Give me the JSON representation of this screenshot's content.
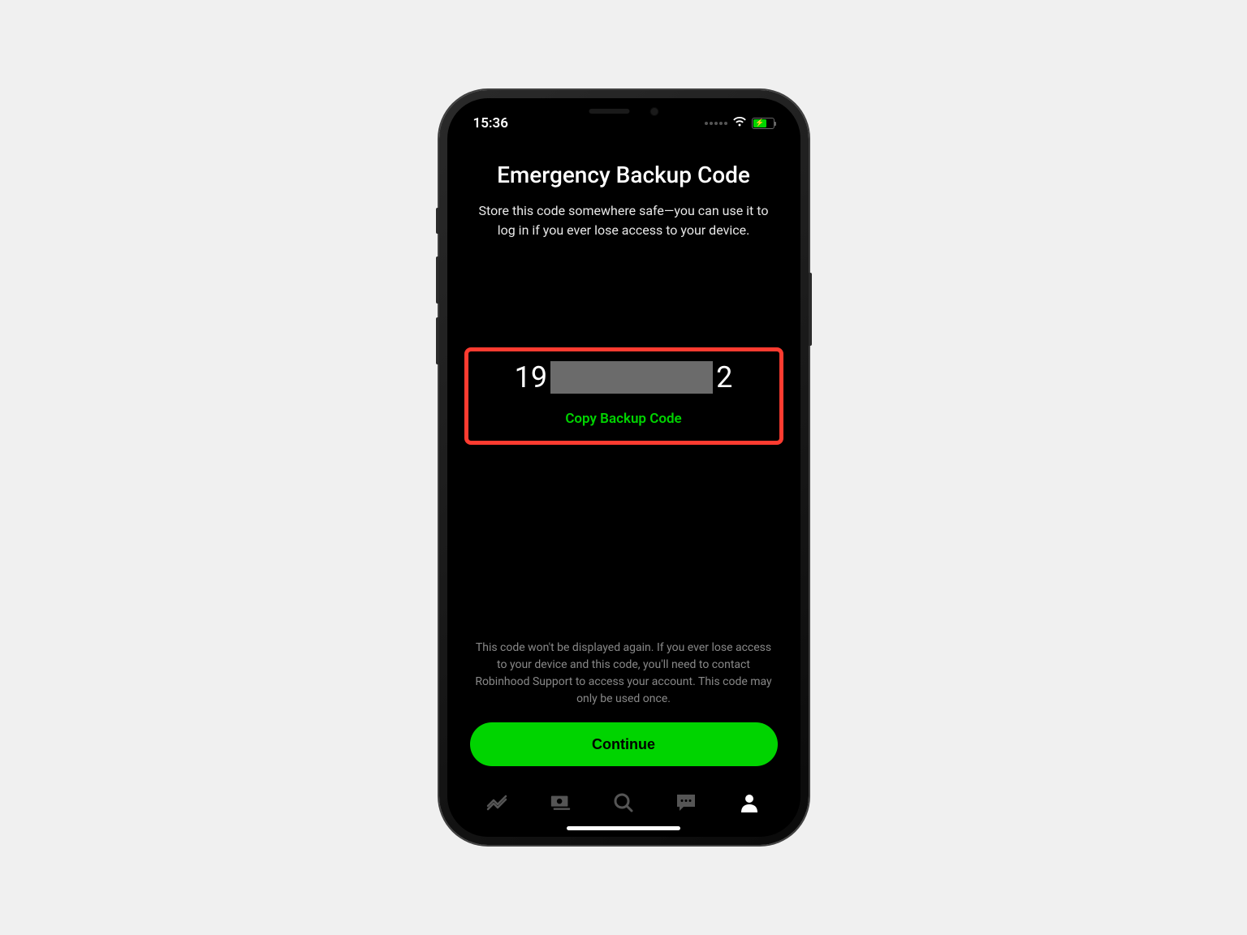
{
  "status_bar": {
    "time": "15:36"
  },
  "page": {
    "title": "Emergency Backup Code",
    "description": "Store this code somewhere safe—you can use it to log in if you ever lose access to your device."
  },
  "backup_code": {
    "prefix": "19",
    "suffix": "2",
    "copy_label": "Copy Backup Code"
  },
  "warning": "This code won't be displayed again. If you ever lose access to your device and this code, you'll need to contact Robinhood Support to access your account. This code may only be used once.",
  "continue_button": "Continue",
  "colors": {
    "accent": "#00d400",
    "highlight": "#ff3b30"
  }
}
